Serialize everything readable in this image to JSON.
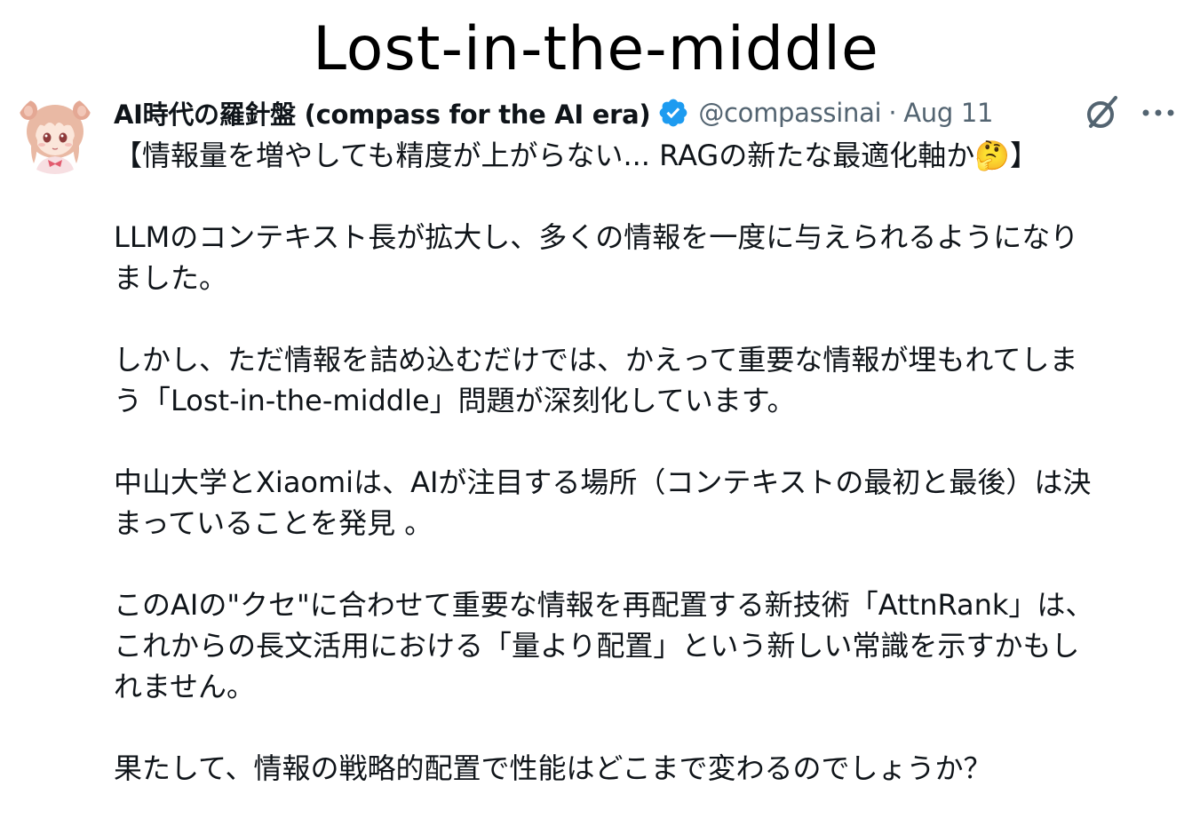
{
  "heading": "Lost-in-the-middle",
  "author": {
    "display_name": "AI時代の羅針盤 (compass for the AI era)",
    "handle": "@compassinai",
    "separator": "·",
    "date": "Aug 11"
  },
  "icons": {
    "verified": "verified-badge-icon",
    "grok": "grok-icon",
    "more": "more-options-icon",
    "avatar": "avatar-anime-girl"
  },
  "colors": {
    "text": "#0f1419",
    "secondary": "#536471",
    "verified": "#1d9bf0"
  },
  "body": {
    "headline_before_emoji": "【情報量を増やしても精度が上がらない... RAGの新たな最適化軸か",
    "headline_emoji": "🤔",
    "headline_after_emoji": "】",
    "p1_line1": "LLMのコンテキスト長が拡大し、多くの情報を一度に与えられるようになり",
    "p1_line2": "ました。",
    "p2_line1": "しかし、ただ情報を詰め込むだけでは、かえって重要な情報が埋もれてしま",
    "p2_line2": "う「Lost-in-the-middle」問題が深刻化しています。",
    "p3_line1": "中山大学とXiaomiは、AIが注目する場所（コンテキストの最初と最後）は決",
    "p3_line2": "まっていることを発見 。",
    "p4_line1": "このAIの\"クセ\"に合わせて重要な情報を再配置する新技術「AttnRank」は、",
    "p4_line2": "これからの長文活用における「量より配置」という新しい常識を示すかもし",
    "p4_line3": "れません。",
    "p5_line1": "果たして、情報の戦略的配置で性能はどこまで変わるのでしょうか？"
  }
}
